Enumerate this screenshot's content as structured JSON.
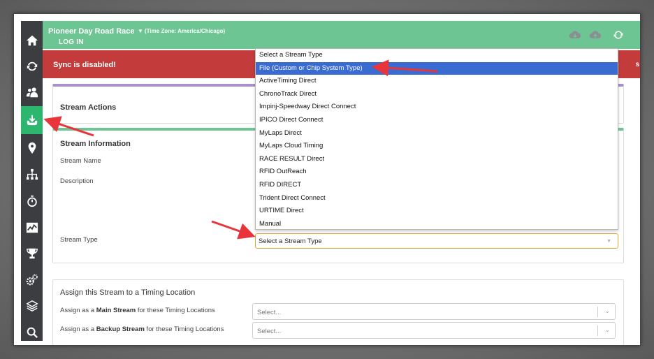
{
  "header": {
    "event_title": "Pioneer Day Road Race",
    "timezone": "(Time Zone: America/Chicago)",
    "login_label": "LOG IN",
    "caret": "▼"
  },
  "sync_banner": {
    "message": "Sync is disabled!",
    "trailing_char": "s"
  },
  "sidebar": {
    "items": [
      {
        "icon": "home-icon",
        "active": false
      },
      {
        "icon": "sync-icon",
        "active": false
      },
      {
        "icon": "users-icon",
        "active": false
      },
      {
        "icon": "download-tray-icon",
        "active": true
      },
      {
        "icon": "map-marker-icon",
        "active": false
      },
      {
        "icon": "sitemap-icon",
        "active": false
      },
      {
        "icon": "stopwatch-icon",
        "active": false
      },
      {
        "icon": "chart-line-icon",
        "active": false
      },
      {
        "icon": "trophy-icon",
        "active": false
      },
      {
        "icon": "gears-icon",
        "active": false
      },
      {
        "icon": "layers-icon",
        "active": false
      },
      {
        "icon": "search-icon",
        "active": false
      }
    ]
  },
  "stream_actions": {
    "title": "Stream Actions"
  },
  "stream_info": {
    "title": "Stream Information",
    "name_label": "Stream Name",
    "description_label": "Description",
    "type_label": "Stream Type",
    "type_value": "Select a Stream Type"
  },
  "stream_type_options": [
    "Select a Stream Type",
    "File (Custom or Chip System Type)",
    "ActiveTiming Direct",
    "ChronoTrack Direct",
    "Impinj-Speedway Direct Connect",
    "IPICO Direct Connect",
    "MyLaps Direct",
    "MyLaps Cloud Timing",
    "RACE RESULT Direct",
    "RFID OutReach",
    "RFID DIRECT",
    "Trident Direct Connect",
    "URTIME Direct",
    "Manual"
  ],
  "highlighted_option": "File (Custom or Chip System Type)",
  "assign": {
    "title": "Assign this Stream to a Timing Location",
    "main_prefix": "Assign as a ",
    "main_bold": "Main Stream",
    "main_suffix": " for these Timing Locations",
    "backup_prefix": "Assign as a ",
    "backup_bold": "Backup Stream",
    "backup_suffix": " for these Timing Locations",
    "main_placeholder": "Select...",
    "backup_placeholder": "Select...",
    "chevron": "⌄"
  },
  "colors": {
    "header_green": "#6cc593",
    "banner_red": "#c43b3b",
    "sidebar_dark": "#3b3d40",
    "active_green": "#2db66d",
    "highlight_blue": "#3a6bd1",
    "annotation_red": "#e8353b"
  }
}
